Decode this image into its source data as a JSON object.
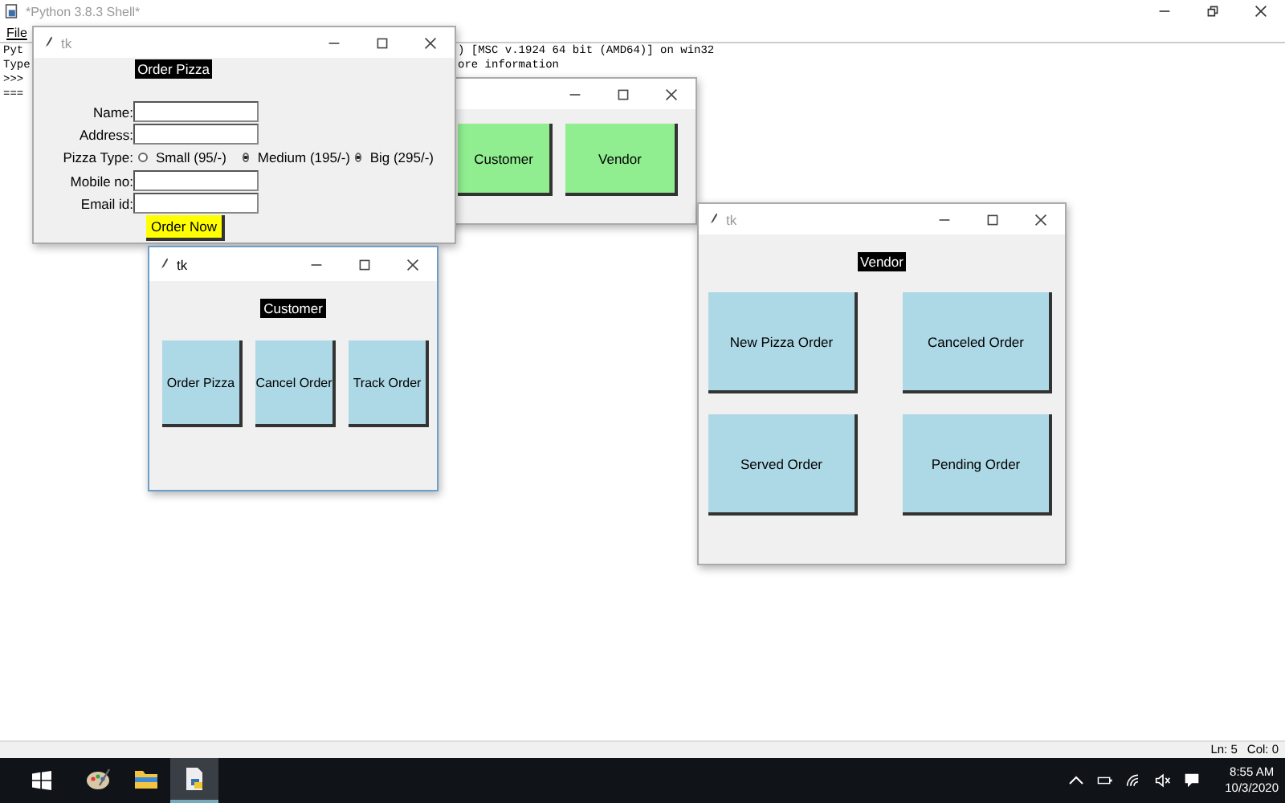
{
  "shell": {
    "title": "*Python 3.8.3 Shell*",
    "menu": [
      "File"
    ],
    "lines": [
      {
        "left": "Pyt",
        "right": ") [MSC v.1924 64 bit (AMD64)] on win32"
      },
      {
        "left": "Type",
        "right": "ore information"
      },
      {
        "left": ">>>"
      },
      {
        "left": "==="
      }
    ],
    "status": [
      "Ln: 5",
      "Col: 0"
    ]
  },
  "windows": [
    {
      "kind": "menu",
      "buttons": [
        "Customer",
        "Vendor"
      ]
    },
    {
      "kind": "form",
      "title": "tk",
      "active": false,
      "heading": "Order Pizza",
      "rows": [
        {
          "kind": "entry",
          "label": "Name:"
        },
        {
          "kind": "entry",
          "label": "Address:"
        },
        {
          "kind": "radio",
          "label": "Pizza Type:",
          "options": [
            {
              "label": "Small (95/-)",
              "selected": false
            },
            {
              "label": "Medium (195/-)",
              "selected": true
            },
            {
              "label": "Big (295/-)",
              "selected": true
            }
          ]
        },
        {
          "kind": "entry",
          "label": "Mobile no:"
        },
        {
          "kind": "entry",
          "label": "Email id:"
        }
      ],
      "button": "Order Now"
    },
    {
      "kind": "buttons",
      "title": "tk",
      "active": true,
      "heading": "Customer",
      "buttons": [
        "Order Pizza",
        "Cancel Order",
        "Track Order"
      ]
    },
    {
      "kind": "buttons",
      "title": "tk",
      "active": false,
      "heading": "Vendor",
      "buttons": [
        "New Pizza Order",
        "Canceled Order",
        "Served Order",
        "Pending Order"
      ]
    }
  ],
  "taskbar": {
    "apps": [
      {
        "kind": "paint",
        "active": false
      },
      {
        "kind": "folder",
        "active": false
      },
      {
        "kind": "python",
        "active": true
      }
    ],
    "time": "8:55 AM",
    "date": "10/3/2020"
  }
}
